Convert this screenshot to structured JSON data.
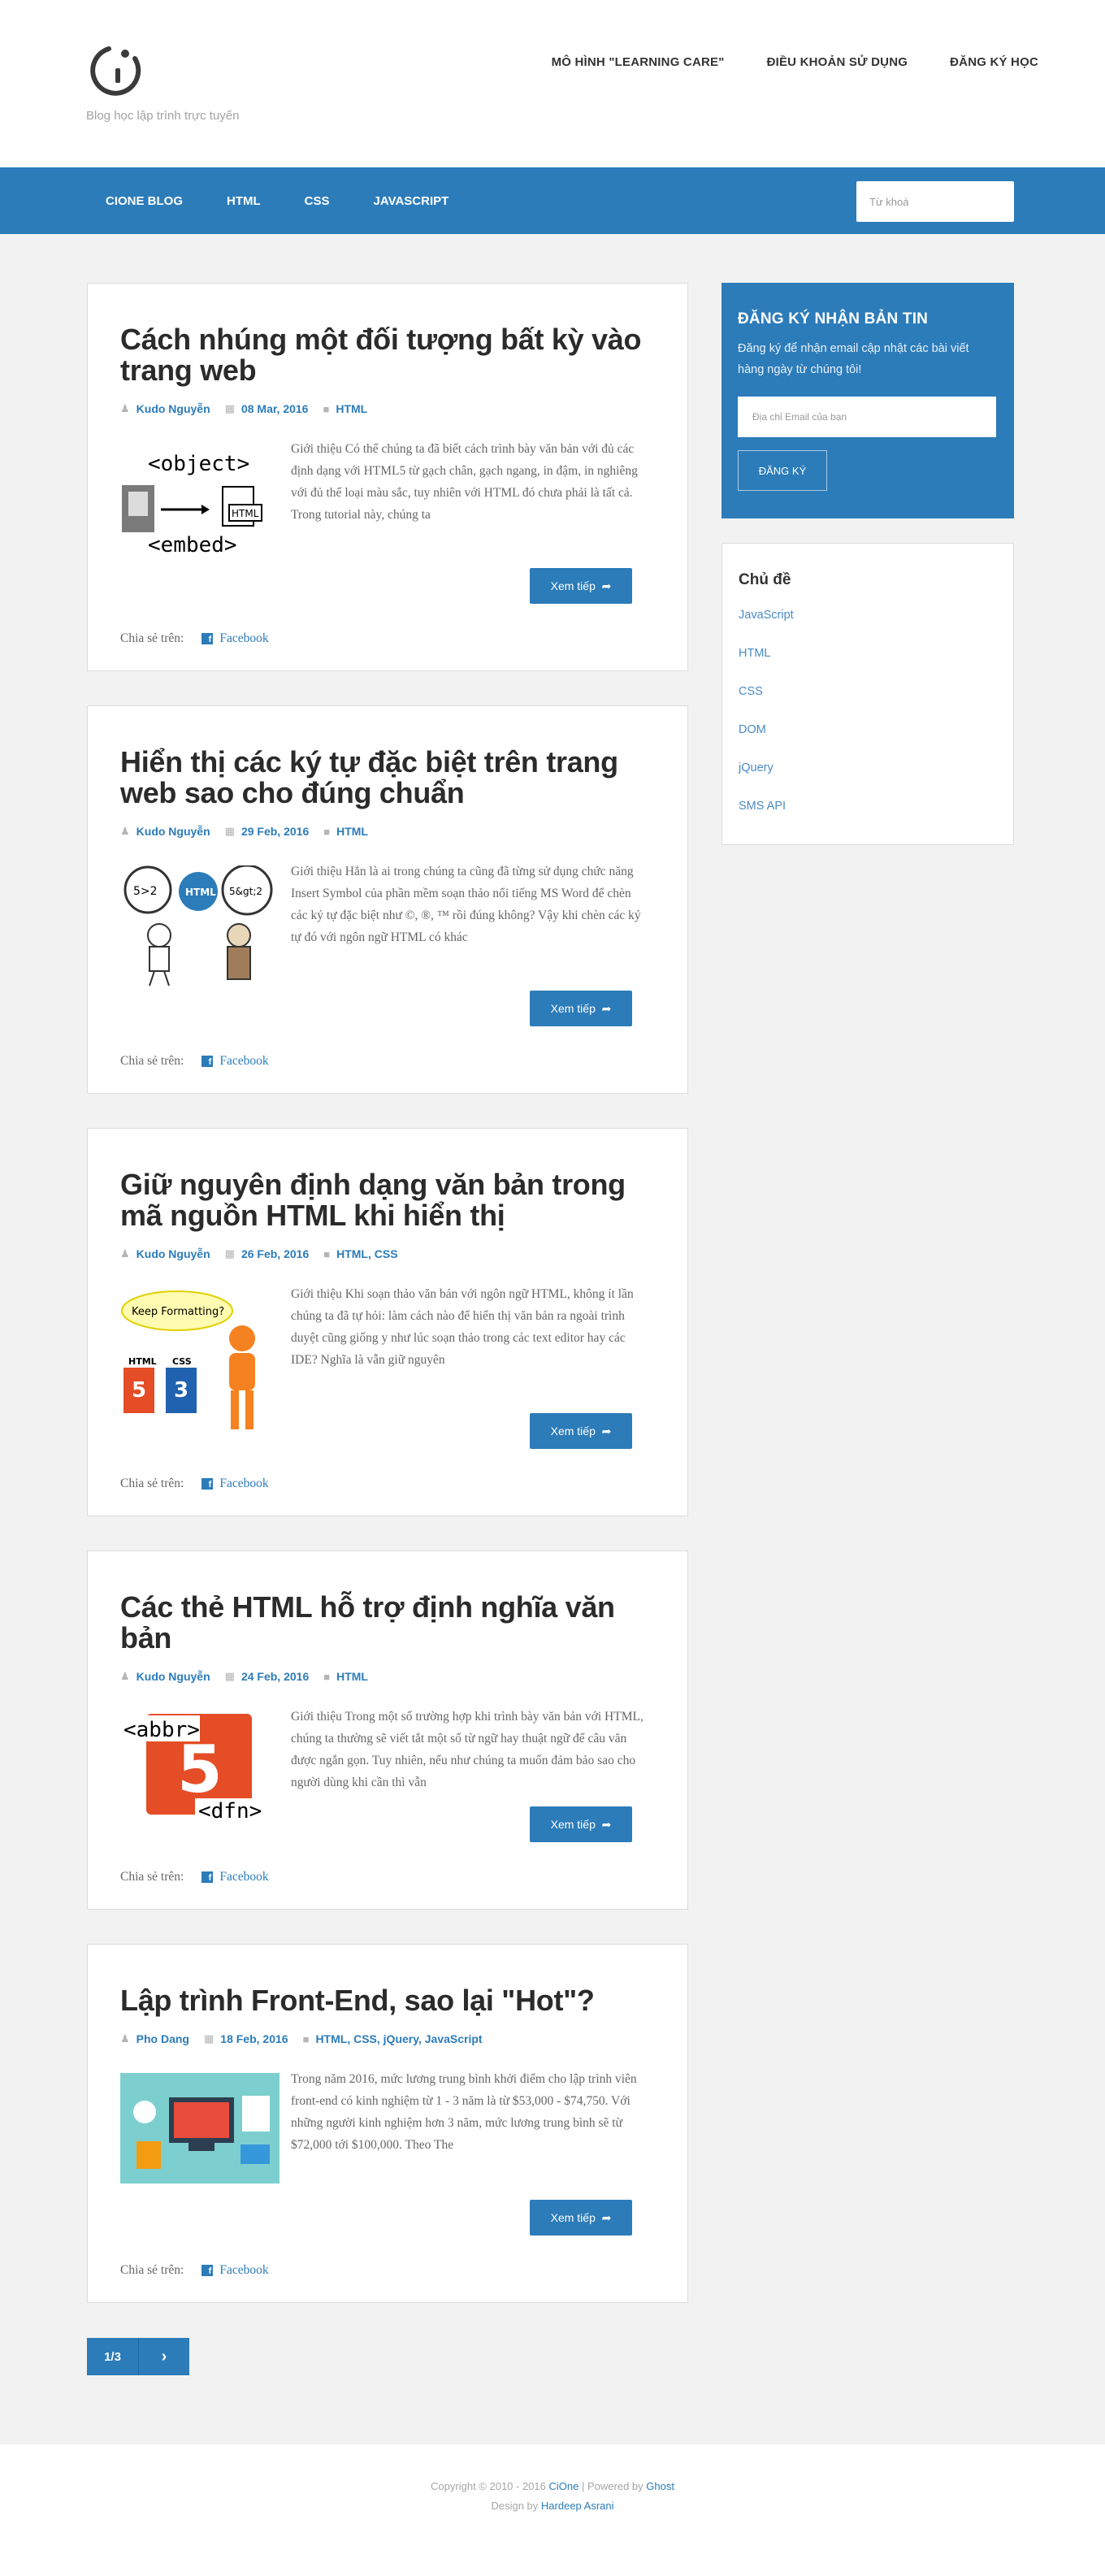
{
  "header": {
    "tagline": "Blog học lập trình trực tuyến",
    "topnav": [
      "MÔ HÌNH \"LEARNING CARE\"",
      "ĐIỀU KHOẢN SỬ DỤNG",
      "ĐĂNG KÝ HỌC"
    ]
  },
  "navbar": {
    "items": [
      "CIONE BLOG",
      "HTML",
      "CSS",
      "JAVASCRIPT"
    ],
    "search_placeholder": "Từ khoá"
  },
  "posts": [
    {
      "title": "Cách nhúng một đối tượng bất kỳ vào trang web",
      "author": "Kudo Nguyễn",
      "date": "08 Mar, 2016",
      "tags": "HTML",
      "excerpt": "Giới thiệu Có thể chúng ta đã biết cách trình bày văn bản với đủ các định dạng với HTML5 từ gạch chân, gạch ngang, in đậm, in nghiêng với đủ thể loại màu sắc, tuy nhiên với HTML đó chưa phải là tất cả. Trong tutorial này, chúng ta",
      "thumb_text_top": "<object>",
      "thumb_text_bottom": "<embed>",
      "thumb_badge": "HTML"
    },
    {
      "title": "Hiển thị các ký tự đặc biệt trên trang web sao cho đúng chuẩn",
      "author": "Kudo Nguyễn",
      "date": "29 Feb, 2016",
      "tags": "HTML",
      "excerpt": "Giới thiệu Hẳn là ai trong chúng ta cũng đã từng sử dụng chức năng Insert Symbol của phần mềm soạn thảo nổi tiếng MS Word để chèn các ký tự đặc biệt như ©, ®, ™ rồi đúng không? Vậy khi chèn các ký tự đó với ngôn ngữ HTML có khác",
      "thumb_bubble_left": "5>2",
      "thumb_bubble_mid": "HTML",
      "thumb_bubble_right": "5&gt;2"
    },
    {
      "title": "Giữ nguyên định dạng văn bản trong mã nguồn HTML khi hiển thị",
      "author": "Kudo Nguyễn",
      "date": "26 Feb, 2016",
      "tags": "HTML, CSS",
      "excerpt": "Giới thiệu Khi soạn thảo văn bản với ngôn ngữ HTML, không ít lần chúng ta đã tự hỏi: làm cách nào để hiển thị văn bản ra ngoài trình duyệt cũng giống y như lúc soạn thảo trong các text editor hay các IDE? Nghĩa là vẫn giữ nguyên",
      "thumb_bubble": "Keep Formatting?",
      "thumb_l1": "HTML",
      "thumb_l2": "CSS"
    },
    {
      "title": "Các thẻ HTML hỗ trợ định nghĩa văn bản",
      "author": "Kudo Nguyễn",
      "date": "24 Feb, 2016",
      "tags": "HTML",
      "excerpt": "Giới thiệu Trong một số trường hợp khi trình bày văn bản với HTML, chúng ta thường sẽ viết tắt một số từ ngữ hay thuật ngữ để câu văn được ngắn gọn. Tuy nhiên, nếu như chúng ta muốn đảm bảo sao cho người dùng khi cần thì vẫn",
      "thumb_text_top": "<abbr>",
      "thumb_text_bottom": "<dfn>"
    },
    {
      "title": "Lập trình Front-End, sao lại \"Hot\"?",
      "author": "Pho Dang",
      "date": "18 Feb, 2016",
      "tags": "HTML, CSS, jQuery, JavaScript",
      "excerpt": "Trong năm 2016, mức lương trung bình khởi điểm cho lập trình viên front-end có kinh nghiệm từ 1 - 3 năm là từ $53,000 - $74,750. Với những người kinh nghiệm hơn 3 năm, mức lương trung bình sẽ từ $72,000 tới $100,000. Theo The"
    }
  ],
  "post_ui": {
    "read_more": "Xem tiếp",
    "share_label": "Chia sẻ trên:",
    "facebook": "Facebook"
  },
  "pagination": {
    "page": "1/3",
    "next": "›"
  },
  "sidebar": {
    "newsletter": {
      "title": "ĐĂNG KÝ NHẬN BẢN TIN",
      "description": "Đăng ký để nhận email cập nhật các bài viết hàng ngày từ chúng tôi!",
      "email_placeholder": "Địa chỉ Email của bạn",
      "button": "ĐĂNG KÝ"
    },
    "topics": {
      "title": "Chủ đề",
      "items": [
        "JavaScript",
        "HTML",
        "CSS",
        "DOM",
        "jQuery",
        "SMS API"
      ]
    }
  },
  "footer": {
    "copyright": "Copyright © 2010 - 2016",
    "brand": "CiOne",
    "powered_by": "| Powered by",
    "ghost": "Ghost",
    "design_by": "Design by",
    "designer": "Hardeep Asrani"
  },
  "colors": {
    "primary": "#2c7cba",
    "background": "#f2f2f2",
    "title": "#2b2b2b"
  }
}
